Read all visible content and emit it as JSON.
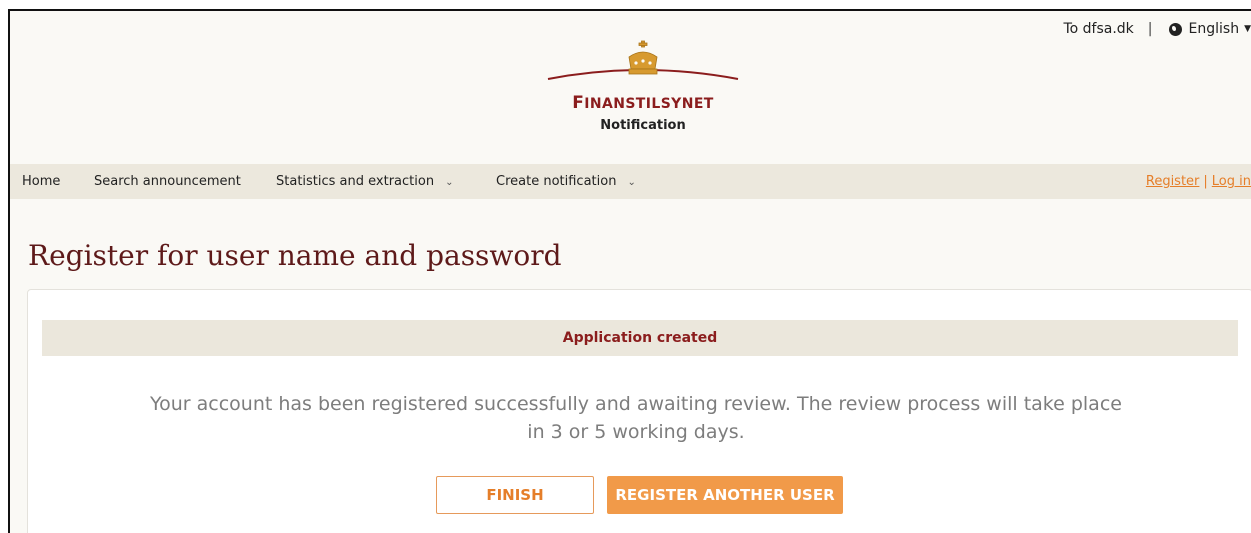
{
  "header": {
    "external_link": "To dfsa.dk",
    "separator": "|",
    "language": "English",
    "brand_first": "F",
    "brand_rest": "INANSTILSYNET",
    "subtitle": "Notification"
  },
  "nav": {
    "items": [
      {
        "label": "Home"
      },
      {
        "label": "Search announcement"
      },
      {
        "label": "Statistics and extraction"
      },
      {
        "label": "Create notification"
      }
    ],
    "dropdown_glyph": "⌄",
    "register": "Register",
    "auth_separator": "|",
    "login": "Log in"
  },
  "page": {
    "title": "Register for user name and password"
  },
  "card": {
    "banner": "Application created",
    "message_line1": "Your account has been registered successfully and awaiting review. The review process will take place",
    "message_line2": "in 3 or 5 working days.",
    "finish_label": "FINISH",
    "register_another_label": "REGISTER ANOTHER USER"
  },
  "colors": {
    "brand_red": "#8b1d1d",
    "title_color": "#5e1a1a",
    "accent_orange": "#f19a49",
    "nav_bg": "#ece8dd",
    "page_bg": "#faf9f5"
  },
  "icons": {
    "language": "globe-icon",
    "logo": "crown-icon"
  }
}
